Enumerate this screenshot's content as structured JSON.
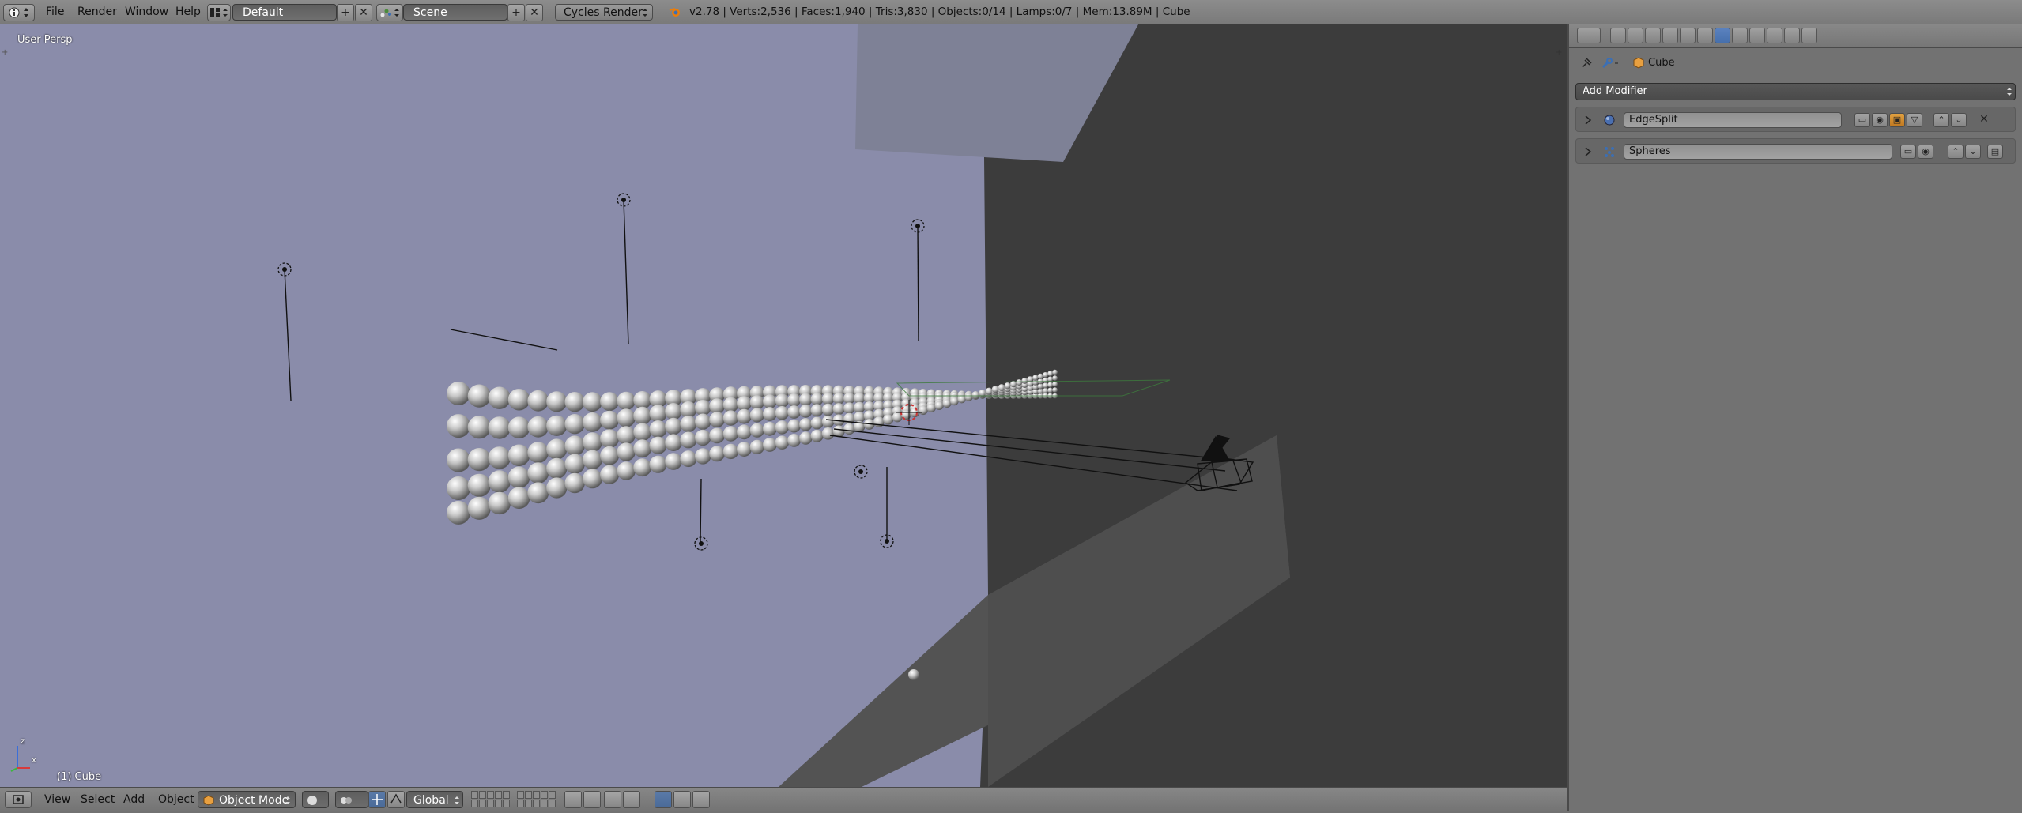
{
  "top_header": {
    "menus": [
      "File",
      "Render",
      "Window",
      "Help"
    ],
    "screen_layout": "Default",
    "scene": "Scene",
    "render_engine": "Cycles Render",
    "stats": "v2.78 | Verts:2,536 | Faces:1,940 | Tris:3,830 | Objects:0/14 | Lamps:0/7 | Mem:13.89M | Cube"
  },
  "viewport": {
    "view_label": "User Persp",
    "object_label": "(1) Cube",
    "axis_labels": {
      "z": "z",
      "x": "x"
    },
    "colors": {
      "sky": "#8a8caa",
      "dark_plane": "#3c3c3c",
      "floor": "#555555"
    }
  },
  "bottom_header": {
    "menus": [
      "View",
      "Select",
      "Add",
      "Object"
    ],
    "mode": "Object Mode",
    "orientation": "Global"
  },
  "properties": {
    "breadcrumb_object": "Cube",
    "add_modifier_label": "Add Modifier",
    "modifiers": [
      {
        "name": "EdgeSplit",
        "icon": "edgesplit-icon"
      },
      {
        "name": "Spheres",
        "icon": "particle-instance-icon"
      }
    ],
    "active_tab": "modifiers",
    "accent_color": "#5b82bf"
  }
}
